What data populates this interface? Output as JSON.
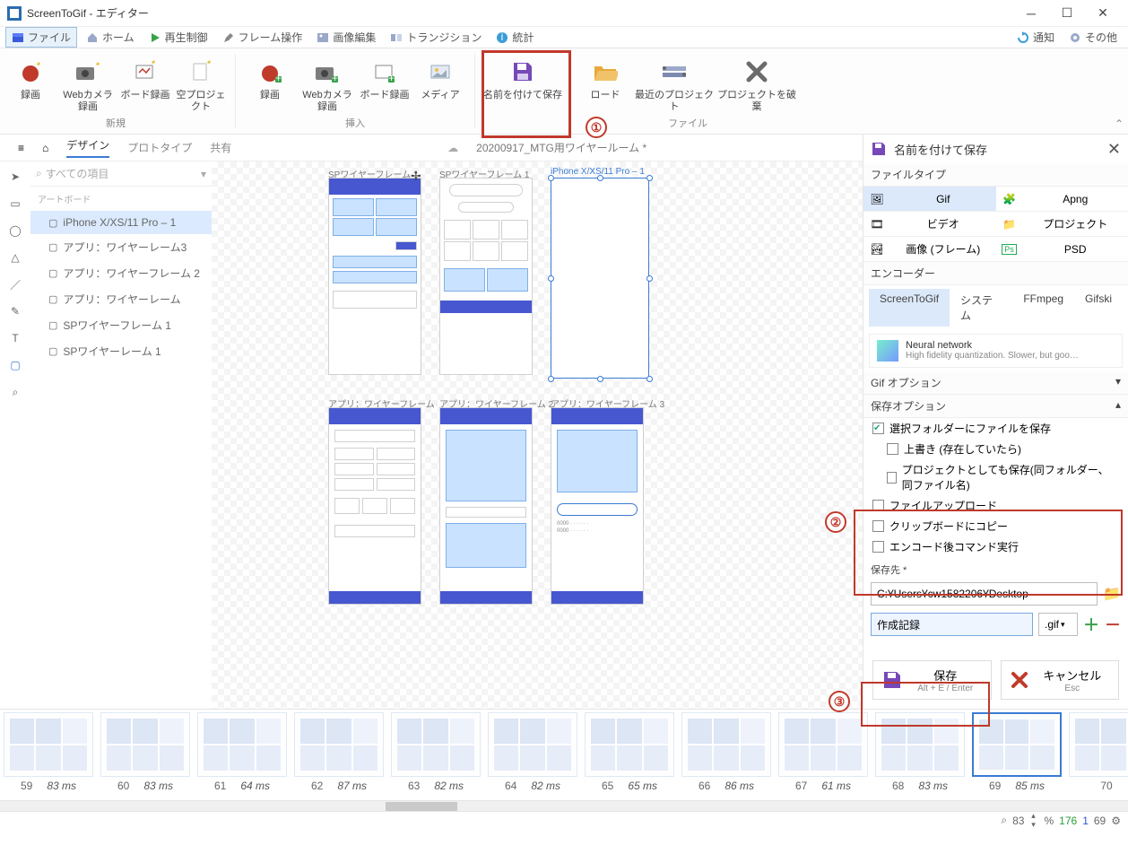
{
  "window": {
    "title": "ScreenToGif - エディター"
  },
  "menu": {
    "file": "ファイル",
    "home": "ホーム",
    "play": "再生制御",
    "frame": "フレーム操作",
    "image": "画像編集",
    "trans": "トランジション",
    "stats": "統計",
    "notify": "通知",
    "other": "その他"
  },
  "ribbon": {
    "new": {
      "group": "新規",
      "rec": "録画",
      "webcam": "Webカメラ録画",
      "board": "ボード録画",
      "blank": "空プロジェクト"
    },
    "insert": {
      "group": "挿入",
      "rec": "録画",
      "webcam": "Webカメラ録画",
      "board": "ボード録画",
      "media": "メディア"
    },
    "save": "名前を付けて保存",
    "file": {
      "group": "ファイル",
      "load": "ロード",
      "recent": "最近のプロジェクト",
      "discard": "プロジェクトを破棄"
    }
  },
  "doc": {
    "menu": "≡",
    "home_ic": "⌂",
    "tabs": {
      "design": "デザイン",
      "proto": "プロトタイプ",
      "share": "共有"
    },
    "title": "20200917_MTG用ワイヤールーム *",
    "search": "すべての項目",
    "listhdr": "アートボード",
    "items": [
      "iPhone X/XS/11 Pro – 1",
      "アプリ：ワイヤーレーム3",
      "アプリ：ワイヤーフレーム 2",
      "アプリ：ワイヤーレーム",
      "SPワイヤーフレーム 1",
      "SPワイヤーレーム 1"
    ],
    "ab": {
      "sp1": "SPワイヤーフレーム 1",
      "sp2": "SPワイヤーフレーム 1",
      "iph": "iPhone X/XS/11 Pro – 1",
      "a1": "アプリ：ワイヤーフレーム",
      "a2": "アプリ：ワイヤーフレーム 2",
      "a3": "アプリ：ワイヤーフレーム 3"
    }
  },
  "save": {
    "title": "名前を付けて保存",
    "ft_hdr": "ファイルタイプ",
    "ft": {
      "gif": "Gif",
      "apng": "Apng",
      "video": "ビデオ",
      "project": "プロジェクト",
      "images": "画像 (フレーム)",
      "psd": "PSD"
    },
    "enc_hdr": "エンコーダー",
    "enc": {
      "stg": "ScreenToGif",
      "sys": "システム",
      "ff": "FFmpeg",
      "gs": "Gifski"
    },
    "nn": {
      "t": "Neural network",
      "d": "High fidelity quantization. Slower, but goo…"
    },
    "gifopt": "Gif オプション",
    "saveopt": "保存オプション",
    "opts": {
      "o1": "選択フォルダーにファイルを保存",
      "o2": "上書き (存在していたら)",
      "o3": "プロジェクトとしても保存(同フォルダー、同ファイル名)",
      "o4": "ファイルアップロード",
      "o5": "クリップボードにコピー",
      "o6": "エンコード後コマンド実行"
    },
    "dest_hdr": "保存先 *",
    "path": "C:¥Users¥cw1582206¥Desktop",
    "name": "作成記録",
    "ext": ".gif",
    "savebtn": "保存",
    "savehint": "Alt + E / Enter",
    "cancel": "キャンセル",
    "cancelhint": "Esc"
  },
  "timeline": [
    {
      "n": 59,
      "ms": "83 ms"
    },
    {
      "n": 60,
      "ms": "83 ms"
    },
    {
      "n": 61,
      "ms": "64 ms"
    },
    {
      "n": 62,
      "ms": "87 ms"
    },
    {
      "n": 63,
      "ms": "82 ms"
    },
    {
      "n": 64,
      "ms": "82 ms"
    },
    {
      "n": 65,
      "ms": "65 ms"
    },
    {
      "n": 66,
      "ms": "86 ms"
    },
    {
      "n": 67,
      "ms": "61 ms"
    },
    {
      "n": 68,
      "ms": "83 ms"
    },
    {
      "n": 69,
      "ms": "85 ms"
    },
    {
      "n": 70,
      "ms": ""
    }
  ],
  "status": {
    "zoom": "83",
    "pct": "%",
    "total": "176",
    "sel": "1",
    "cur": "69"
  },
  "annot": {
    "a1": "①",
    "a2": "②",
    "a3": "③"
  }
}
